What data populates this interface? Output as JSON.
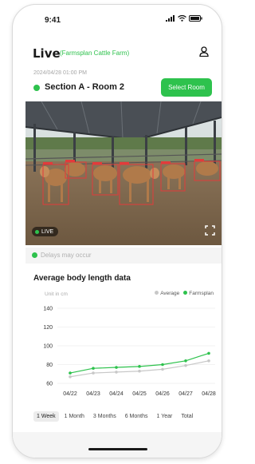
{
  "status_bar": {
    "time": "9:41"
  },
  "header": {
    "title": "Live",
    "farm": "(Farmsplan Cattle Farm)"
  },
  "feed": {
    "datetime": "2024/04/28 01:00 PM",
    "room": "Section A - Room 2",
    "select_label": "Select Room",
    "live_label": "LIVE"
  },
  "notice": {
    "text": "Delays may occur"
  },
  "chart": {
    "title": "Average body length data",
    "unit": "Unit in cm",
    "legend": {
      "average": "Average",
      "farmsplan": "Farmsplan"
    }
  },
  "chart_data": {
    "type": "line",
    "title": "Average body length data",
    "xlabel": "",
    "ylabel": "Unit in cm",
    "categories": [
      "04/22",
      "04/23",
      "04/24",
      "04/25",
      "04/26",
      "04/27",
      "04/28"
    ],
    "ylim": [
      60,
      140
    ],
    "yticks": [
      140,
      120,
      100,
      80,
      60
    ],
    "grid": true,
    "legend_position": "top-right",
    "series": [
      {
        "name": "Average",
        "color": "#c8c8c8",
        "values": [
          67,
          71,
          72,
          73,
          75,
          79,
          84
        ]
      },
      {
        "name": "Farmsplan",
        "color": "#2ec24d",
        "values": [
          71,
          76,
          77,
          78,
          80,
          84,
          92
        ]
      }
    ]
  },
  "ranges": {
    "items": [
      {
        "label": "1 Week",
        "active": true
      },
      {
        "label": "1 Month",
        "active": false
      },
      {
        "label": "3 Months",
        "active": false
      },
      {
        "label": "6 Months",
        "active": false
      },
      {
        "label": "1 Year",
        "active": false
      },
      {
        "label": "Total",
        "active": false
      }
    ]
  },
  "colors": {
    "accent": "#2ec24d",
    "average": "#c8c8c8"
  },
  "icons": {
    "signal": "signal-icon",
    "wifi": "wifi-icon",
    "battery": "battery-icon",
    "user": "user-icon",
    "fullscreen": "fullscreen-icon"
  }
}
